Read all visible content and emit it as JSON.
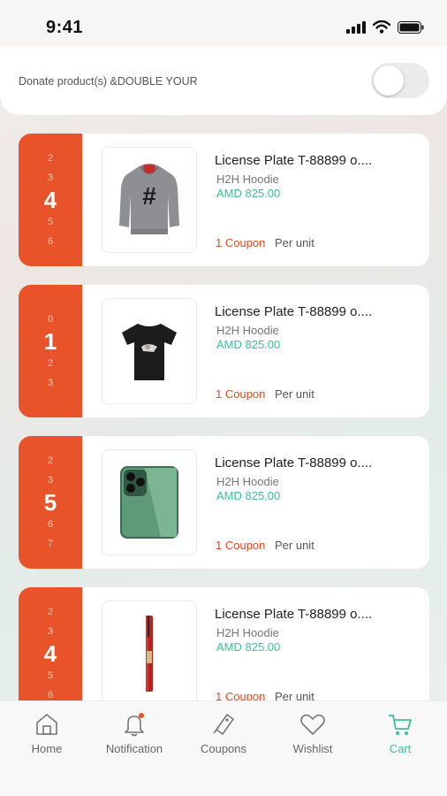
{
  "status": {
    "time": "9:41"
  },
  "donate": {
    "label": "Donate product(s) &DOUBLE YOUR"
  },
  "items": [
    {
      "picker": [
        "2",
        "3",
        "4",
        "5",
        "6"
      ],
      "selected_index": 2,
      "title": "License Plate T-88899 o....",
      "subtitle": "H2H Hoodie",
      "price": "AMD 825.00",
      "coupon": "1 Coupon",
      "per_unit": "Per unit",
      "image": "gray-hoodie"
    },
    {
      "picker": [
        "0",
        "1",
        "2",
        "3"
      ],
      "selected_index": 1,
      "title": "License Plate T-88899 o....",
      "subtitle": "H2H Hoodie",
      "price": "AMD 825.00",
      "coupon": "1 Coupon",
      "per_unit": "Per unit",
      "image": "black-tshirt"
    },
    {
      "picker": [
        "2",
        "3",
        "5",
        "6",
        "7"
      ],
      "selected_index": 2,
      "title": "License Plate T-88899 o....",
      "subtitle": "H2H Hoodie",
      "price": "AMD 825.00",
      "coupon": "1 Coupon",
      "per_unit": "Per unit",
      "image": "green-phone"
    },
    {
      "picker": [
        "2",
        "3",
        "4",
        "5",
        "6"
      ],
      "selected_index": 2,
      "title": "License Plate T-88899 o....",
      "subtitle": "H2H Hoodie",
      "price": "AMD 825.00",
      "coupon": "1 Coupon",
      "per_unit": "Per unit",
      "image": "red-pen"
    }
  ],
  "tabs": [
    {
      "label": "Home",
      "icon": "home-icon",
      "active": false
    },
    {
      "label": "Notification",
      "icon": "bell-icon",
      "active": false
    },
    {
      "label": "Coupons",
      "icon": "coupon-icon",
      "active": false
    },
    {
      "label": "Wishlist",
      "icon": "heart-icon",
      "active": false
    },
    {
      "label": "Cart",
      "icon": "cart-icon",
      "active": true
    }
  ],
  "colors": {
    "accent_orange": "#e8532a",
    "accent_green": "#3cbf9a",
    "coupon_red": "#e04a1e"
  }
}
